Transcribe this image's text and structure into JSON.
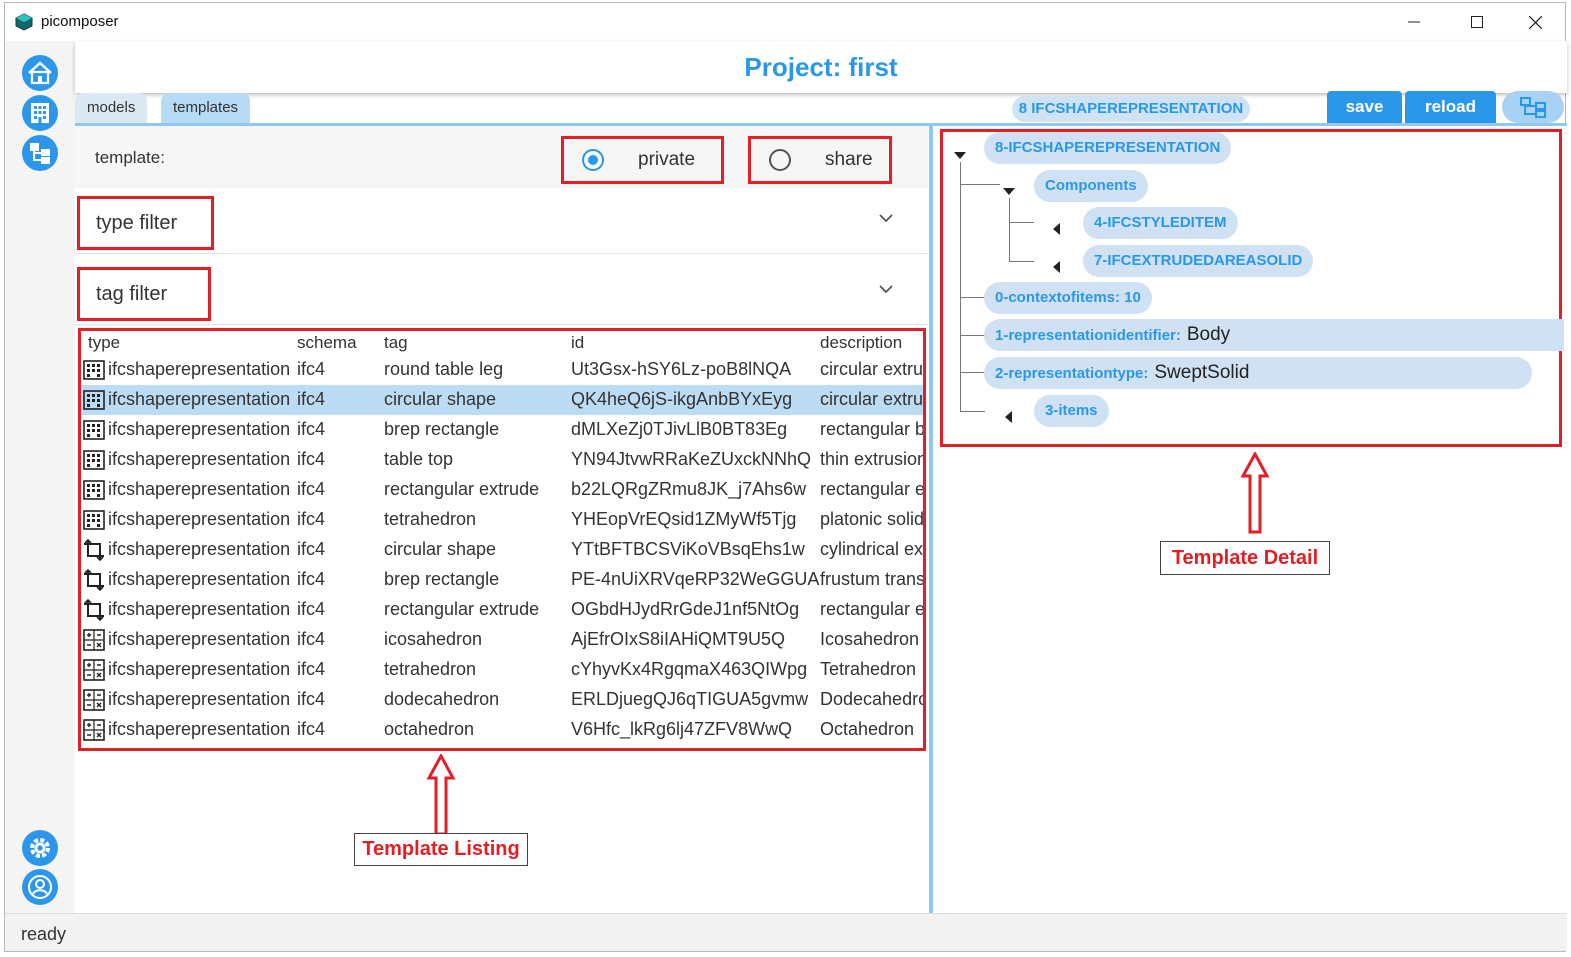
{
  "window": {
    "title": "picomposer"
  },
  "header": {
    "project_title": "Project: first"
  },
  "tabs": [
    {
      "label": "models"
    },
    {
      "label": "templates"
    }
  ],
  "toolbar": {
    "breadcrumb": "8 IFCSHAPEREPRESENTATION",
    "save_label": "save",
    "reload_label": "reload"
  },
  "template_selector": {
    "label": "template:",
    "options": [
      {
        "label": "private",
        "selected": true
      },
      {
        "label": "share",
        "selected": false
      }
    ]
  },
  "filters": {
    "type_label": "type filter",
    "tag_label": "tag filter"
  },
  "listing": {
    "columns": [
      "type",
      "schema",
      "tag",
      "id",
      "description"
    ],
    "rows": [
      {
        "icon": "building-grid-icon",
        "type": "ifcshaperepresentation",
        "schema": "ifc4",
        "tag": "round table leg",
        "id": "Ut3Gsx-hSY6Lz-poB8lNQA",
        "description": "circular extrusi"
      },
      {
        "icon": "building-grid-icon",
        "type": "ifcshaperepresentation",
        "schema": "ifc4",
        "tag": "circular shape",
        "id": "QK4heQ6jS-ikgAnbBYxEyg",
        "description": "circular extrusi"
      },
      {
        "icon": "building-grid-icon",
        "type": "ifcshaperepresentation",
        "schema": "ifc4",
        "tag": "brep rectangle",
        "id": "dMLXeZj0TJivLlB0BT83Eg",
        "description": "rectangular bre"
      },
      {
        "icon": "building-grid-icon",
        "type": "ifcshaperepresentation",
        "schema": "ifc4",
        "tag": "table top",
        "id": "YN94JtvwRRaKeZUxckNNhQ",
        "description": "thin extrusion"
      },
      {
        "icon": "building-grid-icon",
        "type": "ifcshaperepresentation",
        "schema": "ifc4",
        "tag": "rectangular extrude",
        "id": "b22LQRgZRmu8JK_j7Ahs6w",
        "description": "rectangular ex"
      },
      {
        "icon": "building-grid-icon",
        "type": "ifcshaperepresentation",
        "schema": "ifc4",
        "tag": "tetrahedron",
        "id": "YHEopVrEQsid1ZMyWf5Tjg",
        "description": "platonic solid"
      },
      {
        "icon": "crop-arrows-icon",
        "type": "ifcshaperepresentation",
        "schema": "ifc4",
        "tag": "circular shape",
        "id": "YTtBFTBCSViKoVBsqEhs1w",
        "description": "cylindrical ext"
      },
      {
        "icon": "crop-arrows-icon",
        "type": "ifcshaperepresentation",
        "schema": "ifc4",
        "tag": "brep rectangle",
        "id": "PE-4nUiXRVqeRP32WeGGUA",
        "description": "frustum transl"
      },
      {
        "icon": "crop-arrows-icon",
        "type": "ifcshaperepresentation",
        "schema": "ifc4",
        "tag": "rectangular extrude",
        "id": "OGbdHJydRrGdeJ1nf5NtOg",
        "description": "rectangular ex"
      },
      {
        "icon": "calculator-icon",
        "type": "ifcshaperepresentation",
        "schema": "ifc4",
        "tag": "icosahedron",
        "id": "AjEfrOIxS8iIAHiQMT9U5Q",
        "description": "Icosahedron"
      },
      {
        "icon": "calculator-icon",
        "type": "ifcshaperepresentation",
        "schema": "ifc4",
        "tag": "tetrahedron",
        "id": "cYhyvKx4RgqmaX463QIWpg",
        "description": "Tetrahedron"
      },
      {
        "icon": "calculator-icon",
        "type": "ifcshaperepresentation",
        "schema": "ifc4",
        "tag": "dodecahedron",
        "id": "ERLDjuegQJ6qTIGUA5gvmw",
        "description": "Dodecahedron"
      },
      {
        "icon": "calculator-icon",
        "type": "ifcshaperepresentation",
        "schema": "ifc4",
        "tag": "octahedron",
        "id": "V6Hfc_lkRg6lj47ZFV8WwQ",
        "description": "Octahedron"
      }
    ],
    "selected_row": 1
  },
  "tree": {
    "root": "8-IFCSHAPEREPRESENTATION",
    "components": "Components",
    "child_1": "4-IFCSTYLEDITEM",
    "child_2": "7-IFCEXTRUDEDAREASOLID",
    "contextofitems": "0-contextofitems: 10",
    "repid_key": "1-representationidentifier:",
    "repid_val": "Body",
    "reptype_key": "2-representationtype:",
    "reptype_val": "SweptSolid",
    "items": "3-items"
  },
  "annotations": {
    "listing_caption": "Template Listing",
    "detail_caption": "Template Detail"
  },
  "status": {
    "text": "ready"
  },
  "colors": {
    "accent": "#2a98e8",
    "highlight": "#e31e24",
    "selected_row": "#bcdcf5"
  }
}
